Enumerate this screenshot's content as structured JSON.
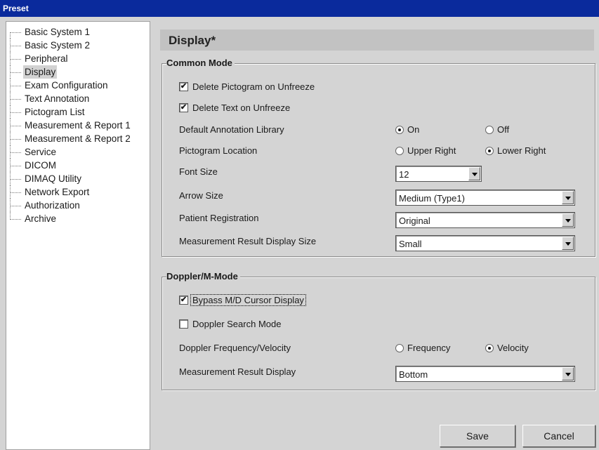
{
  "window": {
    "title": "Preset"
  },
  "tree": {
    "items": [
      {
        "label": "Basic System 1"
      },
      {
        "label": "Basic System 2"
      },
      {
        "label": "Peripheral"
      },
      {
        "label": "Display",
        "selected": true
      },
      {
        "label": "Exam Configuration"
      },
      {
        "label": "Text Annotation"
      },
      {
        "label": "Pictogram List"
      },
      {
        "label": "Measurement & Report 1"
      },
      {
        "label": "Measurement & Report 2"
      },
      {
        "label": "Service"
      },
      {
        "label": "DICOM"
      },
      {
        "label": "DIMAQ Utility"
      },
      {
        "label": "Network Export"
      },
      {
        "label": "Authorization"
      },
      {
        "label": "Archive"
      }
    ]
  },
  "page": {
    "title": "Display*"
  },
  "common_mode": {
    "title": "Common Mode",
    "delete_pictogram": {
      "label": "Delete Pictogram on Unfreeze",
      "checked": true,
      "mark": "✔"
    },
    "delete_text": {
      "label": "Delete Text on Unfreeze",
      "checked": true,
      "mark": "✔"
    },
    "annotation_library": {
      "label": "Default Annotation Library",
      "options": [
        "On",
        "Off"
      ],
      "selected": "On"
    },
    "pictogram_location": {
      "label": "Pictogram Location",
      "options": [
        "Upper Right",
        "Lower Right"
      ],
      "selected": "Lower Right"
    },
    "font_size": {
      "label": "Font Size",
      "value": "12"
    },
    "arrow_size": {
      "label": "Arrow Size",
      "value": "Medium (Type1)"
    },
    "patient_registration": {
      "label": "Patient Registration",
      "value": "Original"
    },
    "measurement_display_size": {
      "label": "Measurement Result Display Size",
      "value": "Small"
    }
  },
  "doppler_mode": {
    "title": "Doppler/M-Mode",
    "bypass_cursor": {
      "label": "Bypass M/D Cursor Display",
      "checked": true,
      "mark": "✔"
    },
    "doppler_search": {
      "label": "Doppler Search Mode",
      "checked": false,
      "mark": ""
    },
    "freq_velocity": {
      "label": "Doppler Frequency/Velocity",
      "options": [
        "Frequency",
        "Velocity"
      ],
      "selected": "Velocity"
    },
    "measurement_display": {
      "label": "Measurement Result Display",
      "value": "Bottom"
    }
  },
  "buttons": {
    "save": "Save",
    "cancel": "Cancel"
  },
  "colors": {
    "titlebar": "#0a2a9c",
    "panel": "#d4d4d4",
    "header": "#c2c2c2"
  }
}
